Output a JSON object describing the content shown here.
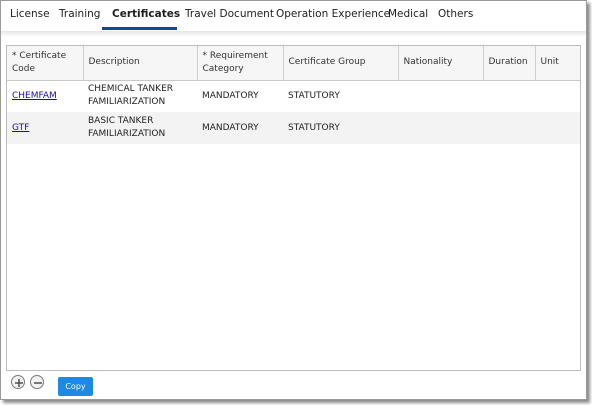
{
  "tabs": [
    {
      "label": "License",
      "active": false
    },
    {
      "label": "Training",
      "active": false
    },
    {
      "label": "Certificates",
      "active": true
    },
    {
      "label": "Travel Document",
      "active": false
    },
    {
      "label": "Operation Experience",
      "active": false
    },
    {
      "label": "Medical",
      "active": false
    },
    {
      "label": "Others",
      "active": false
    }
  ],
  "grid": {
    "columns": [
      {
        "label": "* Certificate Code"
      },
      {
        "label": "Description"
      },
      {
        "label": "* Requirement Category"
      },
      {
        "label": "Certificate Group"
      },
      {
        "label": "Nationality"
      },
      {
        "label": "Duration"
      },
      {
        "label": "Unit"
      }
    ],
    "rows": [
      {
        "code": "CHEMFAM",
        "description": "CHEMICAL TANKER FAMILIARIZATION",
        "requirement": "MANDATORY",
        "group": "STATUTORY",
        "nationality": "",
        "duration": "",
        "unit": ""
      },
      {
        "code": "GTF",
        "description": "BASIC TANKER FAMILIARIZATION",
        "requirement": "MANDATORY",
        "group": "STATUTORY",
        "nationality": "",
        "duration": "",
        "unit": ""
      }
    ]
  },
  "footer": {
    "add_icon": "plus-circle-icon",
    "remove_icon": "minus-circle-icon",
    "copy_label": "Copy"
  },
  "colors": {
    "active_tab_underline": "#0d47a1",
    "copy_button": "#1e88e5",
    "link": "#1a0dab"
  }
}
